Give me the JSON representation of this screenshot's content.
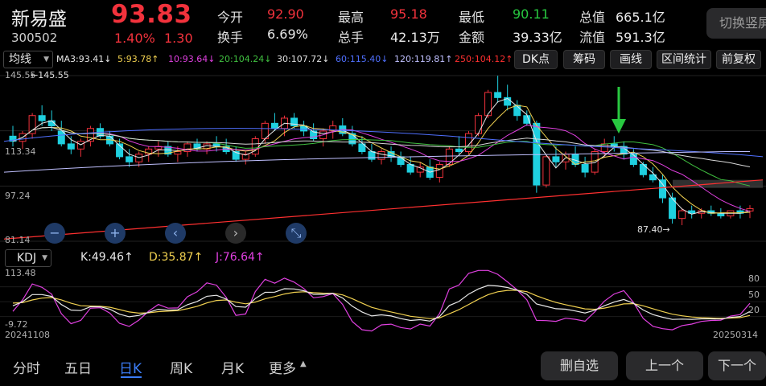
{
  "stock": {
    "name": "新易盛",
    "code": "300502",
    "price": "93.83",
    "change_pct": "1.40%",
    "change": "1.30",
    "quotes": [
      {
        "label": "今开",
        "value": "92.90",
        "color": "red"
      },
      {
        "label": "最高",
        "value": "95.18",
        "color": "red"
      },
      {
        "label": "最低",
        "value": "90.11",
        "color": "green"
      },
      {
        "label": "总值",
        "value": "665.1亿",
        "color": "white"
      },
      {
        "label": "换手",
        "value": "6.69%",
        "color": "white"
      },
      {
        "label": "总手",
        "value": "42.13万",
        "color": "white"
      },
      {
        "label": "金额",
        "value": "39.33亿",
        "color": "white"
      },
      {
        "label": "流值",
        "value": "591.3亿",
        "color": "white"
      }
    ],
    "switch_label": "切换竖屏"
  },
  "ma_bar": {
    "selector": "均线",
    "items": [
      {
        "text": "MA3:93.41↓",
        "color": "#e8e8e8"
      },
      {
        "text": "5:93.78↑",
        "color": "#f0d050"
      },
      {
        "text": "10:93.64↓",
        "color": "#e040e0"
      },
      {
        "text": "20:104.24↓",
        "color": "#40c040"
      },
      {
        "text": "30:107.72↓",
        "color": "#e0e0e0"
      },
      {
        "text": "60:115.40↓",
        "color": "#5070ff"
      },
      {
        "text": "120:119.81↑",
        "color": "#c0c0ff"
      },
      {
        "text": "250:104.12↑",
        "color": "#ff3030"
      }
    ],
    "buttons": [
      "DK点",
      "筹码",
      "画线",
      "区间统计",
      "前复权"
    ]
  },
  "price_axis": {
    "top": "145.55",
    "mid1": "113.34",
    "mid2": "97.24",
    "bottom": "81.14",
    "high_marker": "←145.55",
    "low_marker": "87.40→"
  },
  "kdj": {
    "selector": "KDJ",
    "k": "K:49.46↑",
    "d": "D:35.87↑",
    "j": "J:76.64↑",
    "axis_top": "113.48",
    "axis_bottom": "-9.72",
    "right_ticks": [
      "80",
      "50",
      "20"
    ],
    "date_start": "20241108",
    "date_end": "20250314"
  },
  "colors": {
    "up": "#f2323c",
    "down": "#1fd0e0",
    "accent": "#3b7cf5",
    "arrow": "#28c840"
  },
  "bottom": {
    "tabs": [
      "分时",
      "五日",
      "日K",
      "周K",
      "月K",
      "更多"
    ],
    "active_tab": "日K",
    "buttons": [
      "删自选",
      "上一个",
      "下一个"
    ]
  },
  "candles": [
    [
      122,
      126,
      118,
      120
    ],
    [
      120,
      124,
      117,
      123
    ],
    [
      123,
      131,
      121,
      130
    ],
    [
      130,
      134,
      126,
      128
    ],
    [
      128,
      132,
      124,
      126
    ],
    [
      124,
      128,
      118,
      119
    ],
    [
      119,
      122,
      115,
      117
    ],
    [
      117,
      121,
      114,
      120
    ],
    [
      120,
      126,
      118,
      125
    ],
    [
      125,
      127,
      121,
      122
    ],
    [
      122,
      124,
      118,
      119
    ],
    [
      119,
      121,
      113,
      114
    ],
    [
      114,
      117,
      110,
      112
    ],
    [
      112,
      116,
      110,
      115
    ],
    [
      115,
      118,
      112,
      117
    ],
    [
      117,
      120,
      114,
      118
    ],
    [
      118,
      120,
      114,
      115
    ],
    [
      115,
      118,
      112,
      116
    ],
    [
      116,
      120,
      114,
      119
    ],
    [
      119,
      121,
      116,
      117
    ],
    [
      117,
      120,
      115,
      119
    ],
    [
      119,
      122,
      116,
      118
    ],
    [
      118,
      121,
      115,
      116
    ],
    [
      116,
      118,
      112,
      113
    ],
    [
      113,
      116,
      111,
      115
    ],
    [
      115,
      122,
      114,
      121
    ],
    [
      121,
      128,
      119,
      127
    ],
    [
      127,
      131,
      124,
      125
    ],
    [
      125,
      130,
      122,
      129
    ],
    [
      129,
      131,
      125,
      126
    ],
    [
      126,
      128,
      122,
      124
    ],
    [
      124,
      127,
      120,
      121
    ],
    [
      121,
      125,
      118,
      124
    ],
    [
      124,
      128,
      121,
      126
    ],
    [
      126,
      129,
      122,
      123
    ],
    [
      123,
      126,
      118,
      119
    ],
    [
      119,
      122,
      115,
      116
    ],
    [
      116,
      119,
      112,
      113
    ],
    [
      113,
      117,
      111,
      116
    ],
    [
      116,
      118,
      112,
      114
    ],
    [
      114,
      116,
      110,
      111
    ],
    [
      111,
      114,
      107,
      108
    ],
    [
      108,
      112,
      106,
      110
    ],
    [
      110,
      113,
      105,
      106
    ],
    [
      106,
      112,
      104,
      111
    ],
    [
      111,
      118,
      110,
      117
    ],
    [
      117,
      122,
      115,
      116
    ],
    [
      116,
      124,
      115,
      123
    ],
    [
      123,
      131,
      122,
      130
    ],
    [
      130,
      140,
      129,
      139
    ],
    [
      139,
      145.5,
      135,
      137
    ],
    [
      137,
      142,
      132,
      134
    ],
    [
      134,
      136,
      128,
      130
    ],
    [
      130,
      132,
      126,
      127
    ],
    [
      127,
      128,
      100,
      103
    ],
    [
      103,
      115,
      102,
      114
    ],
    [
      114,
      118,
      110,
      112
    ],
    [
      112,
      116,
      109,
      115
    ],
    [
      115,
      118,
      110,
      111
    ],
    [
      111,
      114,
      106,
      108
    ],
    [
      108,
      117,
      107,
      116
    ],
    [
      116,
      121,
      114,
      119
    ],
    [
      119,
      122,
      116,
      118
    ],
    [
      118,
      120,
      113,
      115
    ],
    [
      115,
      117,
      110,
      111
    ],
    [
      111,
      112,
      106,
      107
    ],
    [
      107,
      110,
      104,
      105
    ],
    [
      105,
      107,
      96,
      98
    ],
    [
      98,
      100,
      88,
      90
    ],
    [
      90,
      94,
      87.4,
      93
    ],
    [
      93,
      95,
      90,
      92
    ],
    [
      92,
      94,
      90,
      93
    ],
    [
      93,
      95,
      91,
      92
    ],
    [
      92,
      94,
      90,
      91
    ],
    [
      91,
      93,
      90,
      93
    ],
    [
      93,
      95,
      90,
      92
    ],
    [
      92.9,
      95.18,
      90.11,
      93.83
    ]
  ]
}
